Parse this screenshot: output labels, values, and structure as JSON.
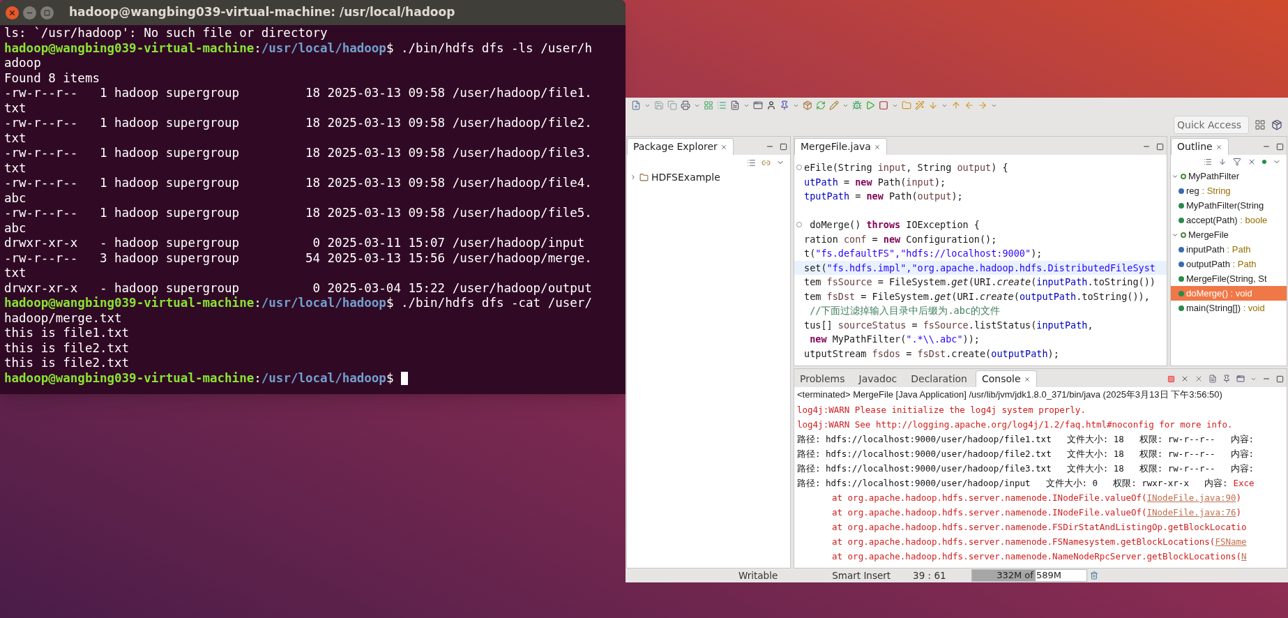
{
  "terminal": {
    "title": "hadoop@wangbing039-virtual-machine: /usr/local/hadoop",
    "lines": [
      {
        "kind": "text",
        "text": "ls: `/usr/hadoop': No such file or directory"
      },
      {
        "kind": "prompt",
        "host": "hadoop@wangbing039-virtual-machine",
        "separator": ":",
        "path": "/usr/local/hadoop",
        "command": "$ ./bin/hdfs dfs -ls /user/h",
        "cursor": false
      },
      {
        "kind": "text",
        "text": "adoop"
      },
      {
        "kind": "text",
        "text": "Found 8 items"
      },
      {
        "kind": "text",
        "text": "-rw-r--r--   1 hadoop supergroup         18 2025-03-13 09:58 /user/hadoop/file1."
      },
      {
        "kind": "text",
        "text": "txt"
      },
      {
        "kind": "text",
        "text": "-rw-r--r--   1 hadoop supergroup         18 2025-03-13 09:58 /user/hadoop/file2."
      },
      {
        "kind": "text",
        "text": "txt"
      },
      {
        "kind": "text",
        "text": "-rw-r--r--   1 hadoop supergroup         18 2025-03-13 09:58 /user/hadoop/file3."
      },
      {
        "kind": "text",
        "text": "txt"
      },
      {
        "kind": "text",
        "text": "-rw-r--r--   1 hadoop supergroup         18 2025-03-13 09:58 /user/hadoop/file4."
      },
      {
        "kind": "text",
        "text": "abc"
      },
      {
        "kind": "text",
        "text": "-rw-r--r--   1 hadoop supergroup         18 2025-03-13 09:58 /user/hadoop/file5."
      },
      {
        "kind": "text",
        "text": "abc"
      },
      {
        "kind": "text",
        "text": "drwxr-xr-x   - hadoop supergroup          0 2025-03-11 15:07 /user/hadoop/input"
      },
      {
        "kind": "text",
        "text": "-rw-r--r--   3 hadoop supergroup         54 2025-03-13 15:56 /user/hadoop/merge."
      },
      {
        "kind": "text",
        "text": "txt"
      },
      {
        "kind": "text",
        "text": "drwxr-xr-x   - hadoop supergroup          0 2025-03-04 15:22 /user/hadoop/output"
      },
      {
        "kind": "prompt",
        "host": "hadoop@wangbing039-virtual-machine",
        "separator": ":",
        "path": "/usr/local/hadoop",
        "command": "$ ./bin/hdfs dfs -cat /user/",
        "cursor": false
      },
      {
        "kind": "text",
        "text": "hadoop/merge.txt"
      },
      {
        "kind": "text",
        "text": "this is file1.txt"
      },
      {
        "kind": "text",
        "text": "this is file2.txt"
      },
      {
        "kind": "text",
        "text": "this is file2.txt"
      },
      {
        "kind": "prompt",
        "host": "hadoop@wangbing039-virtual-machine",
        "separator": ":",
        "path": "/usr/local/hadoop",
        "command": "$",
        "cursor": true
      }
    ]
  },
  "eclipse": {
    "quick_access": {
      "placeholder": "Quick Access"
    },
    "package_explorer": {
      "tab": {
        "label": "Package Explorer",
        "selected": true
      },
      "items": [
        {
          "label": "HDFSExample",
          "expanded": false
        }
      ]
    },
    "editor": {
      "tab": {
        "label": "MergeFile.java",
        "selected": true
      },
      "lines": [
        {
          "foldable": true,
          "current": false,
          "tokens": [
            {
              "kind": "plain",
              "t": "eFile(String "
            },
            {
              "kind": "variable",
              "t": "input"
            },
            {
              "kind": "plain",
              "t": ", String "
            },
            {
              "kind": "variable",
              "t": "output"
            },
            {
              "kind": "plain",
              "t": ") {"
            }
          ]
        },
        {
          "foldable": false,
          "current": false,
          "tokens": [
            {
              "kind": "field",
              "t": "utPath"
            },
            {
              "kind": "plain",
              "t": " = "
            },
            {
              "kind": "keyword",
              "t": "new"
            },
            {
              "kind": "plain",
              "t": " Path("
            },
            {
              "kind": "variable",
              "t": "input"
            },
            {
              "kind": "plain",
              "t": ");"
            }
          ]
        },
        {
          "foldable": false,
          "current": false,
          "tokens": [
            {
              "kind": "field",
              "t": "tputPath"
            },
            {
              "kind": "plain",
              "t": " = "
            },
            {
              "kind": "keyword",
              "t": "new"
            },
            {
              "kind": "plain",
              "t": " Path("
            },
            {
              "kind": "variable",
              "t": "output"
            },
            {
              "kind": "plain",
              "t": ");"
            }
          ]
        },
        {
          "foldable": true,
          "current": false,
          "tokens": [
            {
              "kind": "plain",
              "t": " doMerge() "
            },
            {
              "kind": "keyword",
              "t": "throws"
            },
            {
              "kind": "plain",
              "t": " IOException {"
            }
          ]
        },
        {
          "foldable": false,
          "current": false,
          "tokens": [
            {
              "kind": "plain",
              "t": "ration "
            },
            {
              "kind": "variable",
              "t": "conf"
            },
            {
              "kind": "plain",
              "t": " = "
            },
            {
              "kind": "keyword",
              "t": "new"
            },
            {
              "kind": "plain",
              "t": " Configuration();"
            }
          ]
        },
        {
          "foldable": false,
          "current": false,
          "tokens": [
            {
              "kind": "plain",
              "t": "t("
            },
            {
              "kind": "string",
              "t": "\"fs.defaultFS\",\"hdfs://localhost:9000\""
            },
            {
              "kind": "plain",
              "t": ");"
            }
          ]
        },
        {
          "foldable": false,
          "current": true,
          "tokens": [
            {
              "kind": "plain",
              "t": "set("
            },
            {
              "kind": "string",
              "t": "\"fs.hdfs.impl\",\"org.apache.hadoop.hdfs.DistributedFileSyst"
            }
          ]
        },
        {
          "foldable": false,
          "current": false,
          "tokens": [
            {
              "kind": "plain",
              "t": "tem "
            },
            {
              "kind": "variable",
              "t": "fsSource"
            },
            {
              "kind": "plain",
              "t": " = FileSystem."
            },
            {
              "kind": "italic",
              "t": "get"
            },
            {
              "kind": "plain",
              "t": "(URI."
            },
            {
              "kind": "italic",
              "t": "create"
            },
            {
              "kind": "plain",
              "t": "("
            },
            {
              "kind": "field",
              "t": "inputPath"
            },
            {
              "kind": "plain",
              "t": ".toString())"
            }
          ]
        },
        {
          "foldable": false,
          "current": false,
          "tokens": [
            {
              "kind": "plain",
              "t": "tem "
            },
            {
              "kind": "variable",
              "t": "fsDst"
            },
            {
              "kind": "plain",
              "t": " = FileSystem."
            },
            {
              "kind": "italic",
              "t": "get"
            },
            {
              "kind": "plain",
              "t": "(URI."
            },
            {
              "kind": "italic",
              "t": "create"
            },
            {
              "kind": "plain",
              "t": "("
            },
            {
              "kind": "field",
              "t": "outputPath"
            },
            {
              "kind": "plain",
              "t": ".toString()),"
            }
          ]
        },
        {
          "foldable": false,
          "current": false,
          "tokens": [
            {
              "kind": "comment",
              "t": " //下面过滤掉输入目录中后缀为.abc的文件"
            }
          ]
        },
        {
          "foldable": false,
          "current": false,
          "tokens": [
            {
              "kind": "plain",
              "t": "tus[] "
            },
            {
              "kind": "variable",
              "t": "sourceStatus"
            },
            {
              "kind": "plain",
              "t": " = "
            },
            {
              "kind": "variable",
              "t": "fsSource"
            },
            {
              "kind": "plain",
              "t": ".listStatus("
            },
            {
              "kind": "field",
              "t": "inputPath"
            },
            {
              "kind": "plain",
              "t": ","
            }
          ]
        },
        {
          "foldable": false,
          "current": false,
          "tokens": [
            {
              "kind": "keyword",
              "t": " new"
            },
            {
              "kind": "plain",
              "t": " MyPathFilter("
            },
            {
              "kind": "string",
              "t": "\".*\\\\.abc\""
            },
            {
              "kind": "plain",
              "t": "));"
            }
          ]
        },
        {
          "foldable": false,
          "current": false,
          "tokens": [
            {
              "kind": "plain",
              "t": "utputStream "
            },
            {
              "kind": "variable",
              "t": "fsdos"
            },
            {
              "kind": "plain",
              "t": " = "
            },
            {
              "kind": "variable",
              "t": "fsDst"
            },
            {
              "kind": "plain",
              "t": ".create("
            },
            {
              "kind": "field",
              "t": "outputPath"
            },
            {
              "kind": "plain",
              "t": ");"
            }
          ]
        }
      ]
    },
    "outline": {
      "tab": {
        "label": "Outline",
        "selected": true
      },
      "items": [
        {
          "kind": "class",
          "name": "MyPathFilter",
          "expanded": true,
          "selected": false,
          "children": [
            {
              "kind": "field",
              "name": "reg",
              "type": " : String",
              "selected": false
            },
            {
              "kind": "constructor",
              "name": "MyPathFilter(String",
              "selected": false
            },
            {
              "kind": "method",
              "name": "accept(Path)",
              "type": " : boole",
              "selected": false
            }
          ]
        },
        {
          "kind": "class",
          "name": "MergeFile",
          "expanded": true,
          "selected": false,
          "children": [
            {
              "kind": "field",
              "name": "inputPath",
              "type": " : Path",
              "selected": false
            },
            {
              "kind": "field",
              "name": "outputPath",
              "type": " : Path",
              "selected": false
            },
            {
              "kind": "constructor",
              "name": "MergeFile(String, St",
              "selected": false
            },
            {
              "kind": "method",
              "name": "doMerge()",
              "type": " : void",
              "selected": true
            },
            {
              "kind": "method",
              "name": "main(String[])",
              "type": " : void",
              "selected": false
            }
          ]
        }
      ]
    },
    "console": {
      "tabs": [
        {
          "label": "Problems",
          "selected": false
        },
        {
          "label": "Javadoc",
          "selected": false
        },
        {
          "label": "Declaration",
          "selected": false
        },
        {
          "label": "Console",
          "selected": true
        }
      ],
      "header": "<terminated> MergeFile [Java Application] /usr/lib/jvm/jdk1.8.0_371/bin/java (2025年3月13日 下午3:56:50)",
      "lines": [
        {
          "kind": "warn",
          "text": "log4j:WARN Please initialize the log4j system properly."
        },
        {
          "kind": "warn",
          "text": "log4j:WARN See http://logging.apache.org/log4j/1.2/faq.html#noconfig for more info."
        },
        {
          "kind": "info",
          "parts": [
            "路径: hdfs://localhost:9000/user/hadoop/file1.txt",
            "文件大小: 18",
            "权限: rw-r--r--",
            "内容:"
          ]
        },
        {
          "kind": "info",
          "parts": [
            "路径: hdfs://localhost:9000/user/hadoop/file2.txt",
            "文件大小: 18",
            "权限: rw-r--r--",
            "内容:"
          ]
        },
        {
          "kind": "info",
          "parts": [
            "路径: hdfs://localhost:9000/user/hadoop/file3.txt",
            "文件大小: 18",
            "权限: rw-r--r--",
            "内容:"
          ]
        },
        {
          "kind": "info",
          "parts": [
            "路径: hdfs://localhost:9000/user/hadoop/input",
            "文件大小: 0",
            "权限: rwxr-xr-x",
            "内容:"
          ],
          "error": "Exce"
        },
        {
          "kind": "stack",
          "text": "at org.apache.hadoop.hdfs.server.namenode.INodeFile.valueOf(",
          "link": "INodeFile.java:90",
          "tail": ")"
        },
        {
          "kind": "stack",
          "text": "at org.apache.hadoop.hdfs.server.namenode.INodeFile.valueOf(",
          "link": "INodeFile.java:76",
          "tail": ")"
        },
        {
          "kind": "stack",
          "text": "at org.apache.hadoop.hdfs.server.namenode.FSDirStatAndListingOp.getBlockLocatio"
        },
        {
          "kind": "stack",
          "text": "at org.apache.hadoop.hdfs.server.namenode.FSNamesystem.getBlockLocations(",
          "link": "FSName"
        },
        {
          "kind": "stack",
          "text": "at org.apache.hadoop.hdfs.server.namenode.NameNodeRpcServer.getBlockLocations(",
          "link": "N"
        }
      ]
    },
    "status_bar": {
      "mode": "Writable",
      "insert": "Smart Insert",
      "position": "39 : 61",
      "memory": {
        "text": "332M of 589M",
        "level": 0.56
      }
    }
  }
}
